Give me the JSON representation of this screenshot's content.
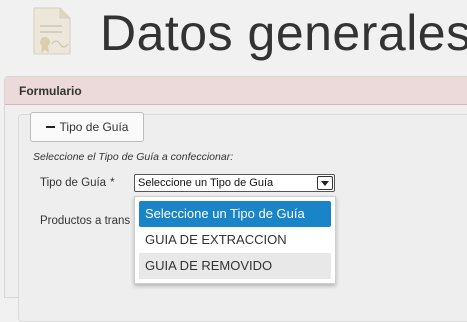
{
  "header": {
    "title": "Datos generales",
    "icon": "document-certificate-icon"
  },
  "panel": {
    "heading": "Formulario"
  },
  "form": {
    "toggle_button_label": "Tipo de Guía",
    "toggle_icon": "minus-icon",
    "hint": "Seleccione el Tipo de Guía a confeccionar:",
    "tipo_label": "Tipo de Guía",
    "required_marker": "*",
    "productos_label": "Productos a trans",
    "select": {
      "value": "Seleccione un Tipo de Guía",
      "options": [
        "Seleccione un Tipo de Guía",
        "GUIA DE EXTRACCION",
        "GUIA DE REMOVIDO"
      ]
    }
  },
  "colors": {
    "selected_option": "#1a84c8",
    "panel_heading": "#ecdadb"
  }
}
